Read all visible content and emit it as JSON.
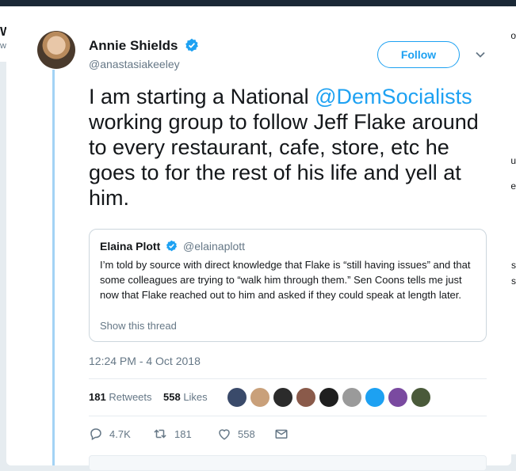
{
  "background": {
    "left_fragment_title": "W",
    "left_fragment_sub": "w",
    "right_fragments": [
      "o",
      "u",
      "e",
      "'s",
      "s"
    ]
  },
  "tweet": {
    "author_name": "Annie Shields",
    "author_handle": "@anastasiakeeley",
    "follow_label": "Follow",
    "text_part1": "I am starting a National ",
    "mention": "@DemSocialists",
    "text_part2": " working group to follow Jeff Flake around to every restaurant, cafe, store, etc he goes to for the rest of his life and yell at him.",
    "timestamp": "12:24 PM - 4 Oct 2018"
  },
  "quoted_tweet": {
    "author_name": "Elaina Plott",
    "author_handle": "@elainaplott",
    "text": "I’m told by source with direct knowledge that Flake is “still having issues” and that some colleagues are trying to “walk him through them.” Sen Coons tells me just now that Flake reached out to him and asked if they could speak at length later.",
    "show_thread_label": "Show this thread"
  },
  "stats": {
    "retweets_count": "181",
    "retweets_label": "Retweets",
    "likes_count": "558",
    "likes_label": "Likes"
  },
  "liker_avatar_colors": [
    "#3a4a6a",
    "#c9a07a",
    "#2b2b2b",
    "#8a5a4a",
    "#1f1f1f",
    "#9a9a9a",
    "#1da1f2",
    "#7a4aa0",
    "#4a5a3a"
  ],
  "actions": {
    "reply_count": "4.7K",
    "retweet_count": "181",
    "like_count": "558"
  },
  "colors": {
    "accent": "#1da1f2",
    "secondary_text": "#657786",
    "thread_line": "#a3d3f5"
  }
}
